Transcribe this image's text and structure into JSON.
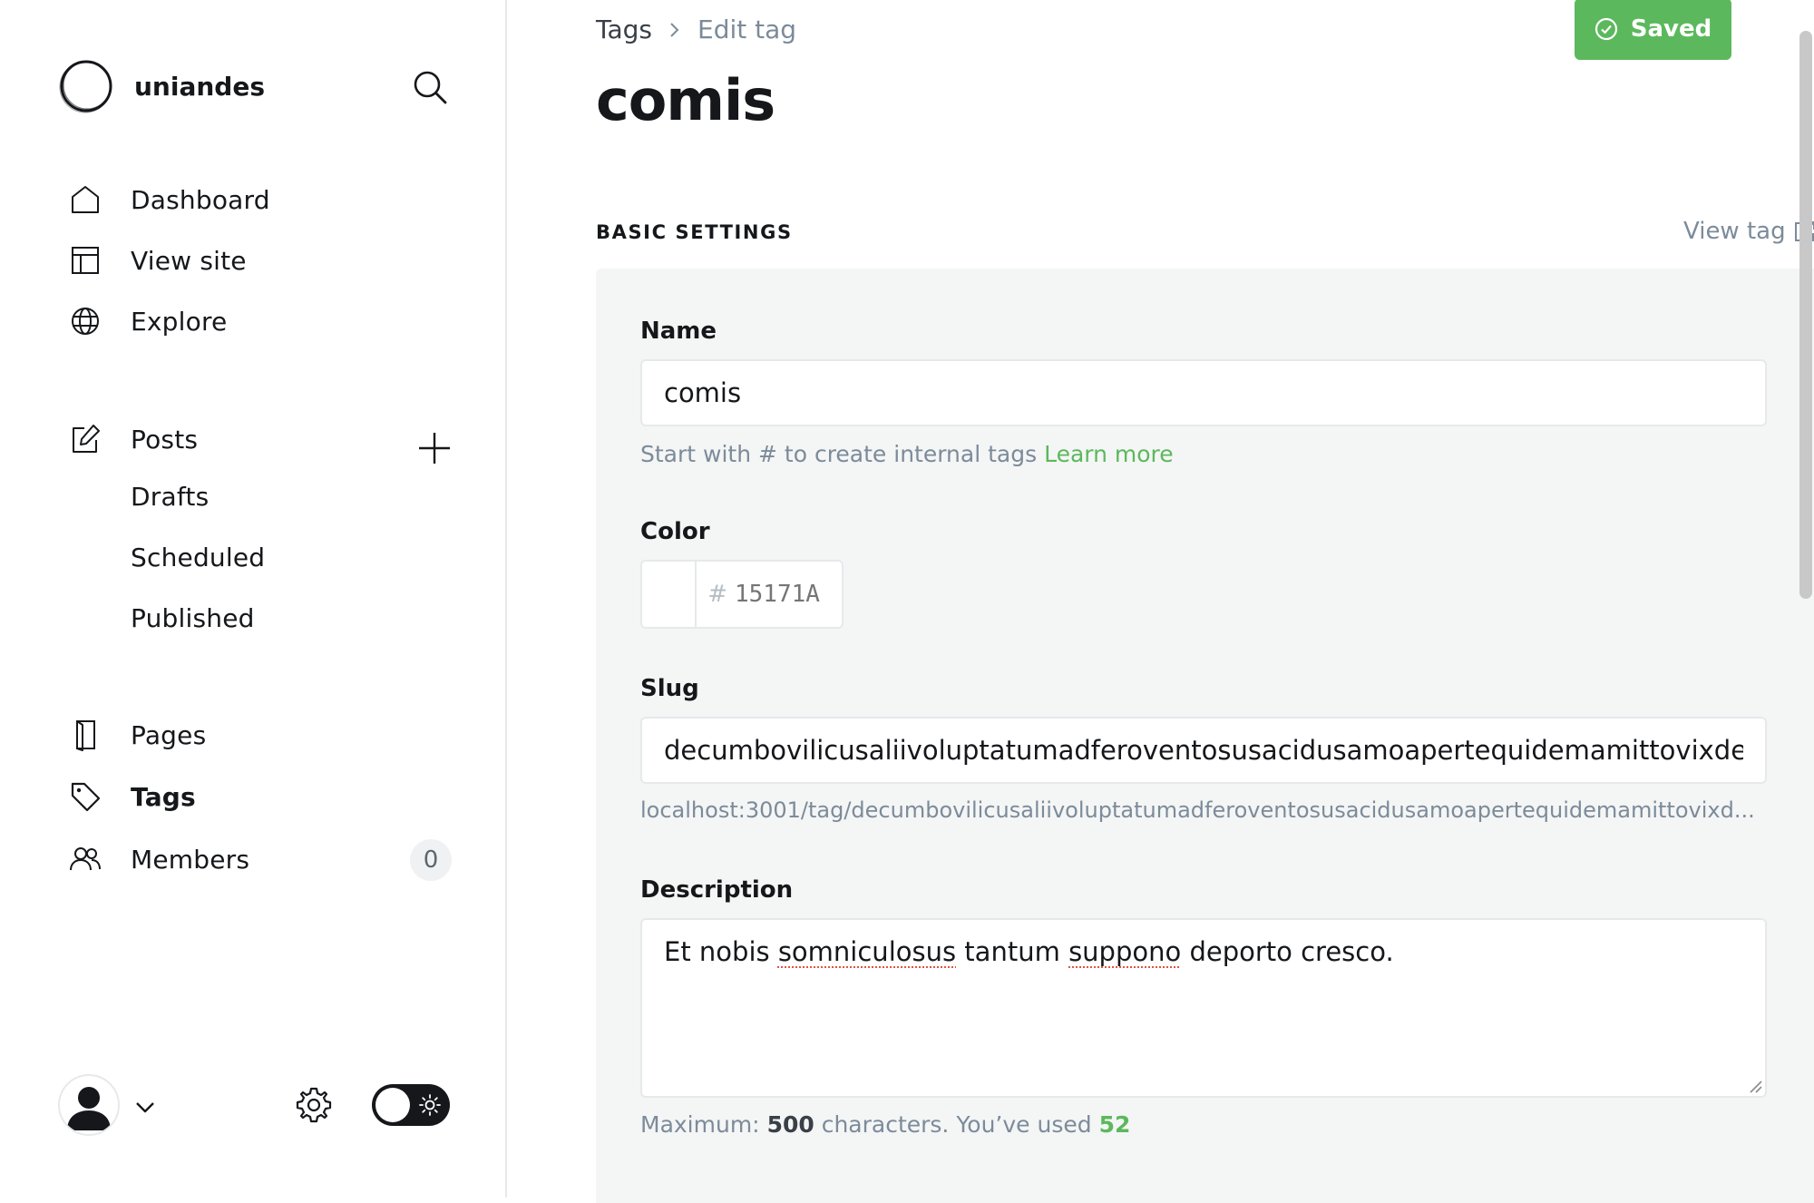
{
  "sidebar": {
    "brand": "uniandes",
    "nav": {
      "dashboard": "Dashboard",
      "view_site": "View site",
      "explore": "Explore",
      "posts": "Posts",
      "drafts": "Drafts",
      "scheduled": "Scheduled",
      "published": "Published",
      "pages": "Pages",
      "tags": "Tags",
      "members": "Members",
      "members_count": "0"
    }
  },
  "header": {
    "breadcrumb_parent": "Tags",
    "breadcrumb_current": "Edit tag",
    "saved_label": "Saved",
    "title": "comis"
  },
  "settings": {
    "section_title": "BASIC SETTINGS",
    "view_tag": "View tag",
    "name_label": "Name",
    "name_value": "comis",
    "name_hint": "Start with # to create internal tags",
    "learn_more": "Learn more",
    "color_label": "Color",
    "color_hash": "#",
    "color_placeholder": "15171A",
    "slug_label": "Slug",
    "slug_value": "decumbovilicusaliivoluptatumadferoventosusacidusamoapertequidemamittovixdemi",
    "url_preview": "localhost:3001/tag/decumbovilicusaliivoluptatumadferoventosusacidusamoapertequidemamittovixd...",
    "description_label": "Description",
    "description": {
      "w1": "Et nobis ",
      "w2": "somniculosus",
      "w3": " tantum ",
      "w4": "suppono",
      "w5": " deporto cresco."
    },
    "counter_prefix": "Maximum: ",
    "counter_max": "500",
    "counter_mid": " characters. You’ve used ",
    "counter_used": "52"
  },
  "colors": {
    "accent_green": "#5cb85c",
    "text_dark": "#15171a",
    "muted": "#7c8b9a",
    "panel_bg": "#f4f5f5"
  }
}
